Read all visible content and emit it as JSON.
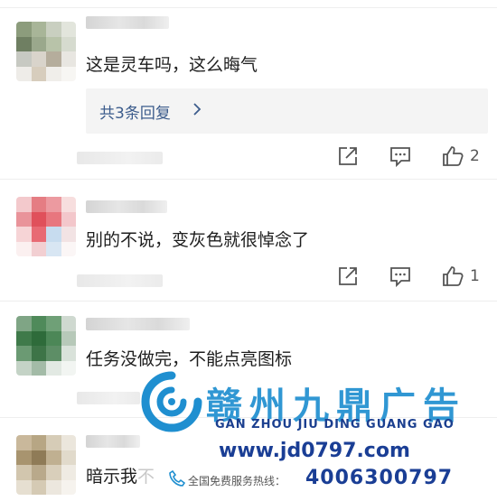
{
  "comments": [
    {
      "text": "这是灵车吗，这么晦气",
      "reply_summary": "共3条回复",
      "like_count": "2"
    },
    {
      "text": "别的不说，变灰色就很悼念了",
      "like_count": "1"
    },
    {
      "text": "任务没做完，不能点亮图标"
    },
    {
      "text_visible": "暗示我",
      "text_faded": "不"
    }
  ],
  "icons": {
    "share": "share-icon",
    "comment": "comment-icon",
    "like": "thumbs-up-icon"
  },
  "watermark": {
    "title": "赣州九鼎广告",
    "pinyin": "GAN ZHOU  JIU  DING  GUANG  GAO",
    "url": "www.jd0797.com",
    "hotline_label": "全国免费服务热线：",
    "hotline_number": "4006300797"
  },
  "colors": {
    "link": "#3c5c8c",
    "watermark_blue": "#1f8fd0",
    "watermark_navy": "#1a3e95"
  }
}
